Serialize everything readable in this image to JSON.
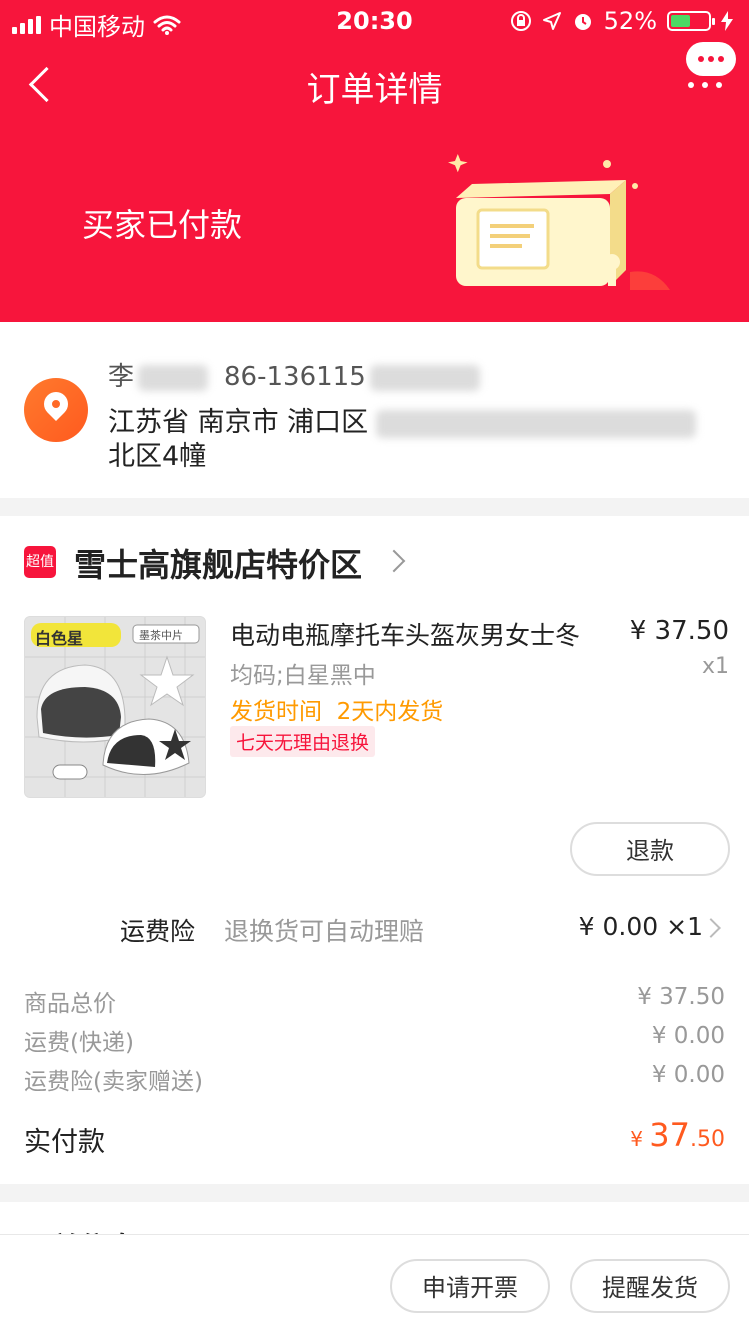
{
  "status_bar": {
    "carrier": "中国移动",
    "time": "20:30",
    "battery": "52%",
    "battery_level": 0.52
  },
  "nav": {
    "title": "订单详情"
  },
  "order": {
    "status": "买家已付款"
  },
  "address": {
    "name": "李",
    "phone": "86-136115",
    "line1": "江苏省 南京市 浦口区",
    "line2": "北区4幢"
  },
  "shop": {
    "badge": "超值",
    "name": "雪士高旗舰店特价区"
  },
  "product": {
    "image_label": "白色星",
    "image_tag": "墨茶中片",
    "title": "电动电瓶摩托车头盔灰男女士冬",
    "price": "¥ 37.50",
    "qty": "x1",
    "spec": "均码;白星黑中",
    "ship_label": "发货时间",
    "ship_value": "2天内发货",
    "tag": "七天无理由退换",
    "refund_button": "退款"
  },
  "insurance": {
    "label": "运费险",
    "desc": "退换货可自动理赔",
    "price": "¥ 0.00 ×1"
  },
  "summary": {
    "items": [
      {
        "label": "商品总价",
        "value": "¥ 37.50"
      },
      {
        "label": "运费(快递)",
        "value": "¥ 0.00"
      },
      {
        "label": "运费险(卖家赠送)",
        "value": "¥ 0.00"
      }
    ],
    "paid_label": "实付款",
    "paid_currency": "¥ ",
    "paid_int": "37",
    "paid_dec": ".50"
  },
  "logistics": {
    "title": "运单信息"
  },
  "bottom": {
    "invoice_button": "申请开票",
    "remind_button": "提醒发货"
  },
  "colors": {
    "brand_red": "#f7153c",
    "accent_orange": "#ff5a1f",
    "ship_orange": "#ff9a00"
  }
}
